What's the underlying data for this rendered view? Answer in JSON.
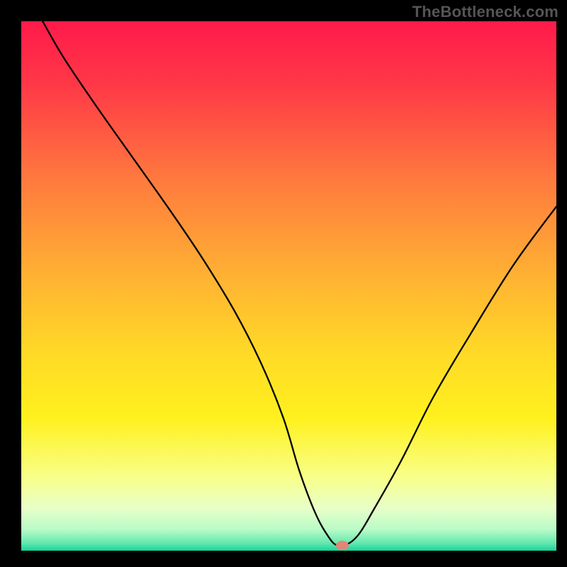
{
  "watermark": "TheBottleneck.com",
  "chart_data": {
    "type": "line",
    "title": "",
    "xlabel": "",
    "ylabel": "",
    "xlim": [
      0,
      100
    ],
    "ylim": [
      0,
      100
    ],
    "background_gradient": {
      "stops": [
        {
          "offset": 0.0,
          "color": "#ff1a4a"
        },
        {
          "offset": 0.12,
          "color": "#ff3847"
        },
        {
          "offset": 0.3,
          "color": "#ff7a3e"
        },
        {
          "offset": 0.48,
          "color": "#ffb133"
        },
        {
          "offset": 0.62,
          "color": "#ffd827"
        },
        {
          "offset": 0.75,
          "color": "#fff11e"
        },
        {
          "offset": 0.86,
          "color": "#f8ff88"
        },
        {
          "offset": 0.92,
          "color": "#e8ffc8"
        },
        {
          "offset": 0.96,
          "color": "#b8fbc7"
        },
        {
          "offset": 0.985,
          "color": "#66e9b0"
        },
        {
          "offset": 1.0,
          "color": "#17d39a"
        }
      ]
    },
    "series": [
      {
        "name": "bottleneck-curve",
        "color": "#000000",
        "width": 2.3,
        "x": [
          4.0,
          8.0,
          14.0,
          21.0,
          28.0,
          34.0,
          40.0,
          45.0,
          49.0,
          52.0,
          55.0,
          57.5,
          59.0,
          60.5,
          63.0,
          66.0,
          71.0,
          77.0,
          84.0,
          92.0,
          100.0
        ],
        "y": [
          100.0,
          93.0,
          84.0,
          74.0,
          64.0,
          55.0,
          45.0,
          35.0,
          25.0,
          15.0,
          7.0,
          2.5,
          1.0,
          1.0,
          3.0,
          8.0,
          17.0,
          29.0,
          41.0,
          54.0,
          65.0
        ]
      }
    ],
    "marker": {
      "name": "optimal-point",
      "x": 60.0,
      "y": 1.0,
      "color": "#e08676",
      "rx": 9,
      "ry": 6.5
    }
  }
}
